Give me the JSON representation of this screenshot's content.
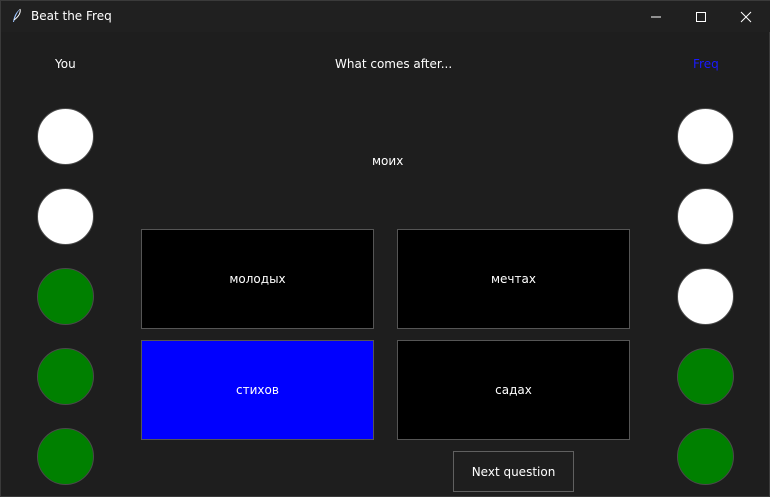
{
  "window": {
    "title": "Beat the Freq",
    "controls": {
      "minimize": "minimize-icon",
      "maximize": "maximize-icon",
      "close": "close-icon"
    }
  },
  "header": {
    "player_label": "You",
    "question": "What comes after...",
    "opponent_label": "Freq"
  },
  "prompt": {
    "word": "моих"
  },
  "answers": [
    {
      "label": "молодых",
      "selected": false
    },
    {
      "label": "мечтах",
      "selected": false
    },
    {
      "label": "стихов",
      "selected": true
    },
    {
      "label": "садах",
      "selected": false
    }
  ],
  "player_lights": [
    "white",
    "white",
    "green",
    "green",
    "green"
  ],
  "opponent_lights": [
    "white",
    "white",
    "white",
    "green",
    "green"
  ],
  "colors": {
    "background": "#1e1e1e",
    "selected_answer": "#0000ff",
    "answer_bg": "#000000",
    "light_on": "#008000",
    "light_off": "#ffffff",
    "opponent_label": "#1a1aff"
  },
  "actions": {
    "next_label": "Next question"
  }
}
